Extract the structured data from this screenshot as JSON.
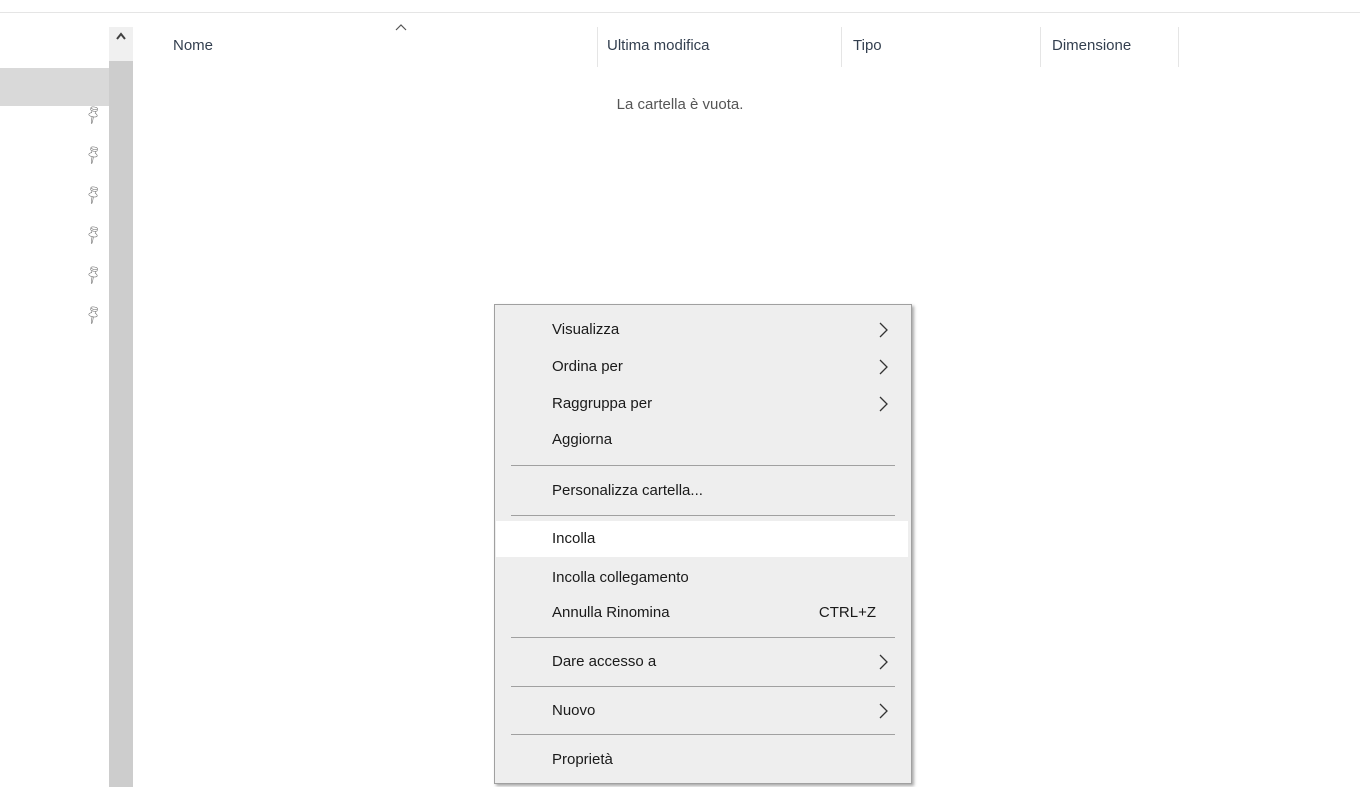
{
  "columns": {
    "name": "Nome",
    "modified": "Ultima modifica",
    "type": "Tipo",
    "size": "Dimensione"
  },
  "empty_message": "La cartella è vuota.",
  "nav": {
    "pinned_icon": "pin-icon",
    "pinned_count": 6
  },
  "context_menu": {
    "view": "Visualizza",
    "sort_by": "Ordina per",
    "group_by": "Raggruppa per",
    "refresh": "Aggiorna",
    "customize": "Personalizza cartella...",
    "paste": "Incolla",
    "paste_shortcut": "Incolla collegamento",
    "undo_rename": "Annulla Rinomina",
    "undo_rename_shortcut": "CTRL+Z",
    "give_access": "Dare accesso a",
    "new": "Nuovo",
    "properties": "Proprietà"
  },
  "colors": {
    "menu_bg": "#eeeeee",
    "menu_hover": "#ffffff",
    "header_text": "#333f4f"
  }
}
